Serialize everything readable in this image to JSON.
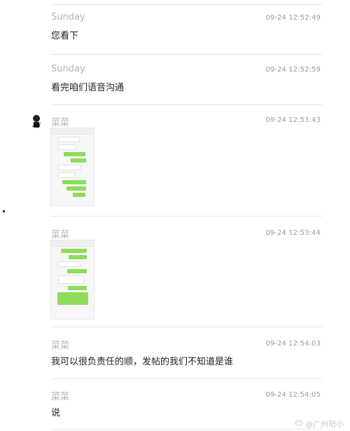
{
  "messages": [
    {
      "sender": "Sunday",
      "time": "09-24 12:52:49",
      "text": "您看下"
    },
    {
      "sender": "Sunday",
      "time": "09-24 12:52:59",
      "text": "看完咱们语音沟通"
    },
    {
      "sender": "菜菜",
      "time": "09-24 12:53:43",
      "avatar_text": "zql"
    },
    {
      "sender": "菜菜",
      "time": "09-24 12:53:44"
    },
    {
      "sender": "菜菜",
      "time": "09-24 12:54:03",
      "text": "我可以很负责任的顺，发帖的我们不知道是谁"
    },
    {
      "sender": "菜菜",
      "time": "09-24 12:54:05",
      "text": "说"
    }
  ],
  "watermark": {
    "text": "@广州阳小"
  },
  "colors": {
    "divider": "#e6e6e6",
    "sender": "#b3b3b3",
    "time": "#999999",
    "content": "#222222",
    "chat_green": "#8fdc5a"
  }
}
